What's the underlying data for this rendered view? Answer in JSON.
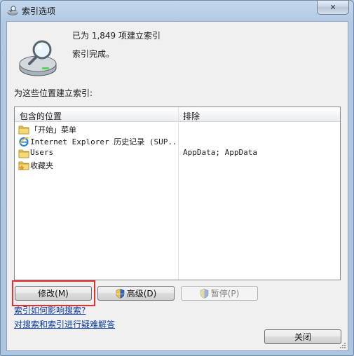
{
  "window": {
    "title": "索引选项",
    "close_glyph": "✕",
    "icon": "indexing-options-icon"
  },
  "status": {
    "indexed_count": "已为 1,849 项建立索引",
    "state": "索引完成。",
    "icon": "drive-magnifier-icon"
  },
  "locations": {
    "label": "为这些位置建立索引:",
    "columns": {
      "included": "包含的位置",
      "excluded": "排除"
    },
    "rows": [
      {
        "icon": "folder-icon",
        "location": "「开始」菜单",
        "exclude": ""
      },
      {
        "icon": "internet-explorer-icon",
        "location": "Internet Explorer 历史记录 (SUP...",
        "exclude": ""
      },
      {
        "icon": "folder-icon",
        "location": "Users",
        "exclude": "AppData; AppData"
      },
      {
        "icon": "folder-star-icon",
        "location": "收藏夹",
        "exclude": ""
      }
    ]
  },
  "buttons": {
    "modify": "修改(M)",
    "advanced": "高级(D)",
    "pause": "暂停(P)",
    "close": "关闭"
  },
  "links": {
    "how_index_affects_search": "索引如何影响搜索?",
    "troubleshoot": "对搜索和索引进行疑难解答"
  },
  "colors": {
    "highlight_box": "#e8302f",
    "link": "#0f3ea8"
  }
}
